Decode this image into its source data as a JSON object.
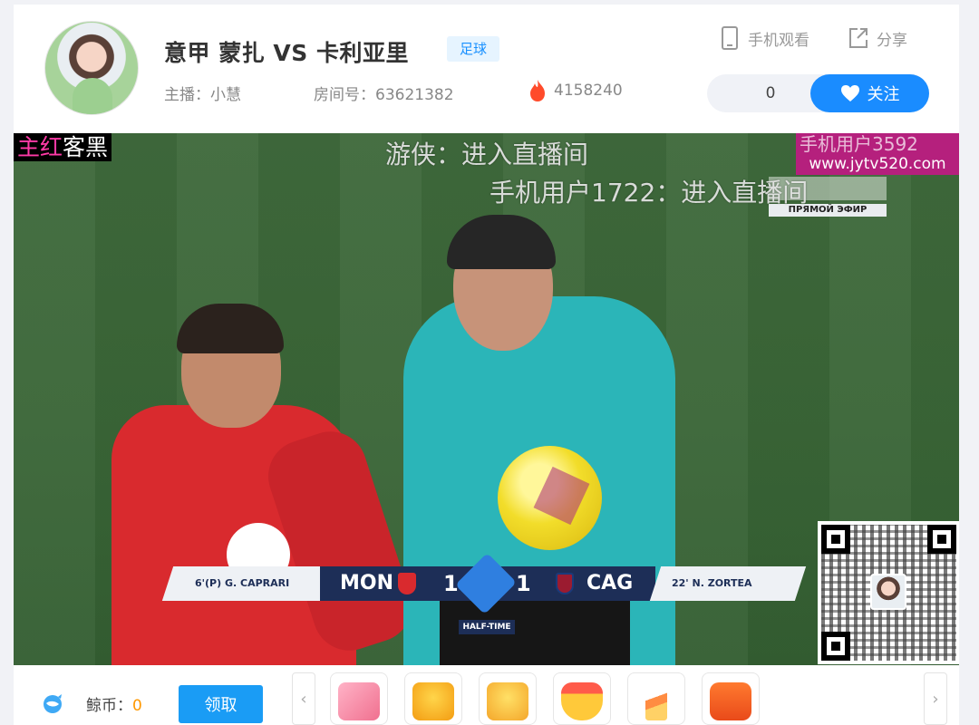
{
  "header": {
    "title": "意甲 蒙扎 VS 卡利亚里",
    "category_tag": "足球",
    "host": "主播：小慧",
    "room": "房间号：63621382",
    "heat": "4158240",
    "actions": {
      "phone_watch": "手机观看",
      "share": "分享"
    },
    "follow": {
      "count": "0",
      "label": "关注"
    }
  },
  "video": {
    "watermark_left_prefix": "主红",
    "watermark_left_suffix": "客黑",
    "watermark_right_top": "手机用户3592",
    "watermark_right_url": "www.jytv520.com",
    "danmaku": [
      "游侠：进入直播间",
      "手机用户1722：进入直播间"
    ],
    "live_caption": "ПРЯМОЙ ЭФИР",
    "scoreboard": {
      "home_scorer": "6'(P)  G. CAPRARI",
      "home_team": "MON",
      "home_score": "1",
      "away_score": "1",
      "away_team": "CAG",
      "away_scorer": "22'  N. ZORTEA",
      "period": "HALF-TIME"
    }
  },
  "bottom": {
    "coin_label": "鲸币：",
    "coin_value": "0",
    "claim_label": "领取",
    "prev_arrow": "‹",
    "next_arrow": "›",
    "gifts": [
      "gift-1",
      "gift-2",
      "gift-3",
      "gift-4",
      "gift-5",
      "gift-6"
    ]
  },
  "colors": {
    "accent": "#1a8cff",
    "tag_bg": "#e6f4ff",
    "coin": "#ff9800",
    "watermark_pink": "#ff3aa7"
  },
  "icons": {
    "phone": "phone-icon",
    "share": "share-icon",
    "heat": "flame-icon",
    "heart": "heart-icon",
    "coin": "whale-coin-icon"
  }
}
